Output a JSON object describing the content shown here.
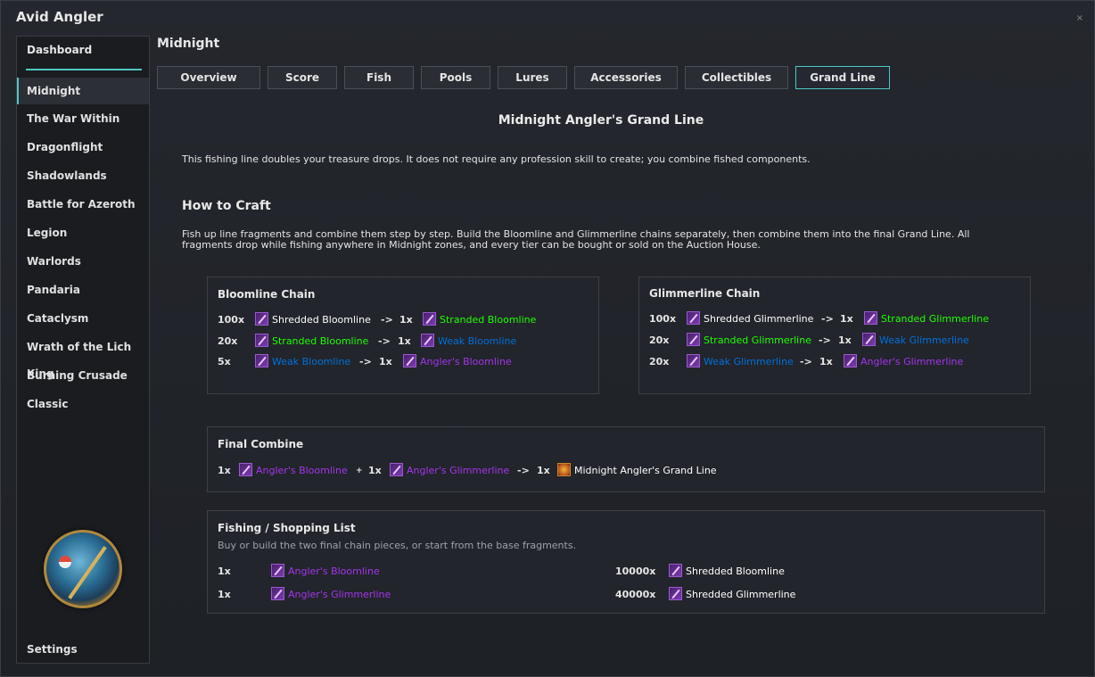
{
  "app": {
    "title": "Avid Angler",
    "close": "×"
  },
  "sidebar": {
    "dashboard": "Dashboard",
    "items": [
      {
        "label": "Midnight"
      },
      {
        "label": "The War Within"
      },
      {
        "label": "Dragonflight"
      },
      {
        "label": "Shadowlands"
      },
      {
        "label": "Battle for Azeroth"
      },
      {
        "label": "Legion"
      },
      {
        "label": "Warlords"
      },
      {
        "label": "Pandaria"
      },
      {
        "label": "Cataclysm"
      },
      {
        "label": "Wrath of the Lich King"
      },
      {
        "label": "Burning Crusade"
      },
      {
        "label": "Classic"
      }
    ],
    "settings": "Settings"
  },
  "main": {
    "title": "Midnight",
    "tabs": [
      {
        "label": "Overview"
      },
      {
        "label": "Score"
      },
      {
        "label": "Fish"
      },
      {
        "label": "Pools"
      },
      {
        "label": "Lures"
      },
      {
        "label": "Accessories"
      },
      {
        "label": "Collectibles"
      },
      {
        "label": "Grand Line"
      }
    ],
    "heading": "Midnight Angler's Grand Line",
    "intro": "This fishing line doubles your treasure drops. It does not require any profession skill to create; you combine fished components.",
    "howto_title": "How to Craft",
    "howto_text": "Fish up line fragments and combine them step by step. Build the Bloomline and Glimmerline chains separately, then combine them into the final Grand Line. All fragments drop while fishing anywhere in Midnight zones, and every tier can be bought or sold on the Auction House.",
    "bloom": {
      "title": "Bloomline Chain",
      "rows": [
        {
          "qty": "100x",
          "from": "Shredded Bloomline",
          "arrow": "->",
          "out_qty": "1x",
          "to": "Stranded Bloomline"
        },
        {
          "qty": "20x",
          "from": "Stranded Bloomline",
          "arrow": "->",
          "out_qty": "1x",
          "to": "Weak Bloomline"
        },
        {
          "qty": "5x",
          "from": "Weak Bloomline",
          "arrow": "->",
          "out_qty": "1x",
          "to": "Angler's Bloomline"
        }
      ]
    },
    "glimmer": {
      "title": "Glimmerline Chain",
      "rows": [
        {
          "qty": "100x",
          "from": "Shredded Glimmerline",
          "arrow": "->",
          "out_qty": "1x",
          "to": "Stranded Glimmerline"
        },
        {
          "qty": "20x",
          "from": "Stranded Glimmerline",
          "arrow": "->",
          "out_qty": "1x",
          "to": "Weak Glimmerline"
        },
        {
          "qty": "20x",
          "from": "Weak Glimmerline",
          "arrow": "->",
          "out_qty": "1x",
          "to": "Angler's Glimmerline"
        }
      ]
    },
    "final": {
      "title": "Final Combine",
      "qty1": "1x",
      "item1": "Angler's Bloomline",
      "plus": "+",
      "qty2": "1x",
      "item2": "Angler's Glimmerline",
      "arrow": "->",
      "qty3": "1x",
      "item3": "Midnight Angler's Grand Line"
    },
    "shopping": {
      "title": "Fishing / Shopping List",
      "subtitle": "Buy or build the two final chain pieces, or start from the base fragments.",
      "left": [
        {
          "qty": "1x",
          "item": "Angler's Bloomline"
        },
        {
          "qty": "1x",
          "item": "Angler's Glimmerline"
        }
      ],
      "right": [
        {
          "qty": "10000x",
          "item": "Shredded Bloomline"
        },
        {
          "qty": "40000x",
          "item": "Shredded Glimmerline"
        }
      ]
    }
  },
  "colors": {
    "accent": "#4fc7c1",
    "common": "#ffffff",
    "uncommon": "#1eff00",
    "rare": "#0070dd",
    "epic": "#a335ee"
  }
}
